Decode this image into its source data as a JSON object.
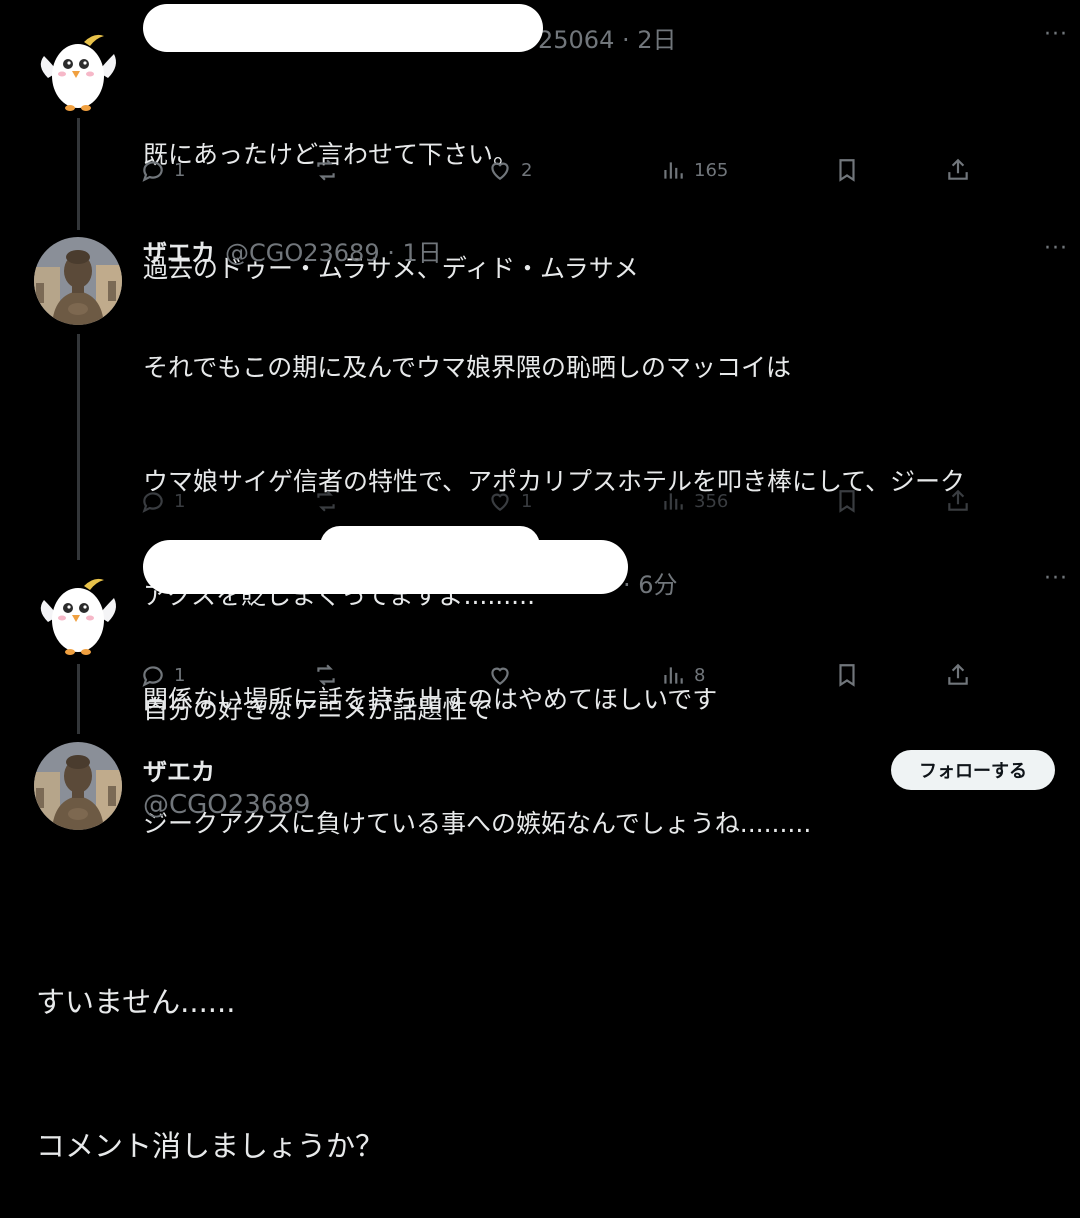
{
  "tweets": [
    {
      "handle_suffix": "25064",
      "time": "2日",
      "lines": [
        "既にあったけど言わせて下さい。",
        "過去のドゥー・ムラサメ、ディド・ムラサメ"
      ],
      "replies": "1",
      "retweets": "",
      "likes": "2",
      "views": "165",
      "avatar_icon": "white-bird-avatar"
    },
    {
      "name": "ザエカ",
      "handle": "@CGO23689",
      "time": "1日",
      "lines": [
        "それでもこの期に及んでウマ娘界隈の恥晒しのマッコイは",
        "ウマ娘サイゲ信者の特性で、アポカリプスホテルを叩き棒にして、ジーク",
        "アクスを貶しまくってますよ.........",
        "自分の好きなアニメが話題性で",
        "ジークアクスに負けている事への嫉妬なんでしょうね........."
      ],
      "replies": "1",
      "retweets": "",
      "likes": "1",
      "views": "356",
      "avatar_icon": "buddha-statue-avatar"
    },
    {
      "time": "6分",
      "lines": [
        "関係ない場所に話を持ち出すのはやめてほしいです"
      ],
      "replies": "1",
      "retweets": "",
      "likes": "",
      "views": "8",
      "avatar_icon": "white-bird-avatar"
    }
  ],
  "final_post": {
    "name": "ザエカ",
    "handle": "@CGO23689",
    "follow_label": "フォローする",
    "lines": [
      "すいません......",
      "コメント消しましょうか？"
    ]
  },
  "more_label": "···",
  "colors": {
    "background": "#000000",
    "text": "#e7e9ea",
    "muted": "#71767b",
    "button": "#eff3f4"
  }
}
